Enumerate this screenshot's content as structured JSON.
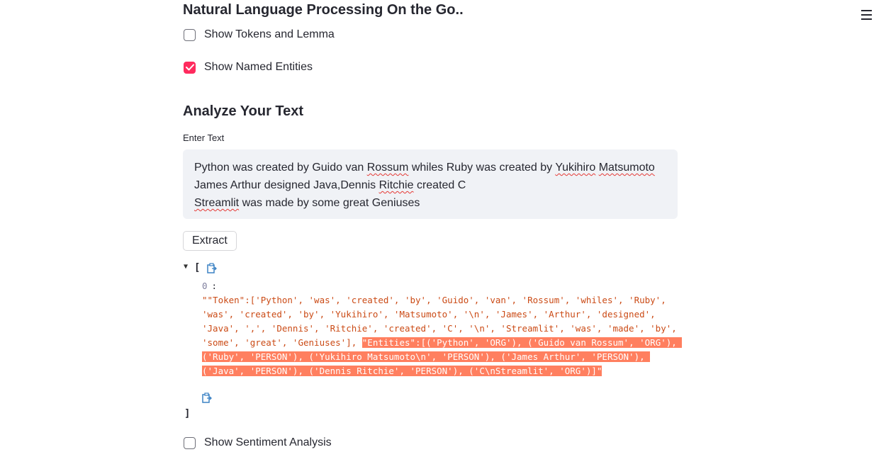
{
  "app": {
    "title": "Natural Language Processing On the Go..",
    "menu_icon": "hamburger-menu-icon"
  },
  "options": {
    "show_tokens": {
      "label": "Show Tokens and Lemma",
      "checked": false
    },
    "show_entities": {
      "label": "Show Named Entities",
      "checked": true
    },
    "show_sentiment": {
      "label": "Show Sentiment Analysis",
      "checked": false
    }
  },
  "analyze": {
    "header": "Analyze Your Text",
    "input_label": "Enter Text",
    "text_lines": [
      "Python was created by Guido van Rossum whiles Ruby was created by Yukihiro Matsumoto",
      "James Arthur designed Java,Dennis Ritchie created C",
      "Streamlit was made by some great Geniuses"
    ],
    "extract_button": "Extract"
  },
  "result": {
    "open_bracket": "[",
    "close_bracket": "]",
    "index": "0",
    "colon": ":",
    "value_plain": "\"\"Token\":['Python', 'was', 'created', 'by', 'Guido', 'van', 'Rossum', 'whiles', 'Ruby', 'was', 'created', 'by', 'Yukihiro', 'Matsumoto', '\\n', 'James', 'Arthur', 'designed', 'Java', ',', 'Dennis', 'Ritchie', 'created', 'C', '\\n', 'Streamlit', 'was', 'made', 'by', 'some', 'great', 'Geniuses'], ",
    "value_highlighted": "\"Entities\":[('Python', 'ORG'), ('Guido van Rossum', 'ORG'), ('Ruby', 'PERSON'), ('Yukihiro Matsumoto\\n', 'PERSON'), ('James Arthur', 'PERSON'), ('Java', 'PERSON'), ('Dennis Ritchie', 'PERSON'), ('C\\nStreamlit', 'ORG')]\""
  },
  "colors": {
    "accent": "#ff2b5e",
    "json_string": "#cb4b16",
    "highlight": "#ff7f5f",
    "input_bg": "#f0f2f6"
  }
}
